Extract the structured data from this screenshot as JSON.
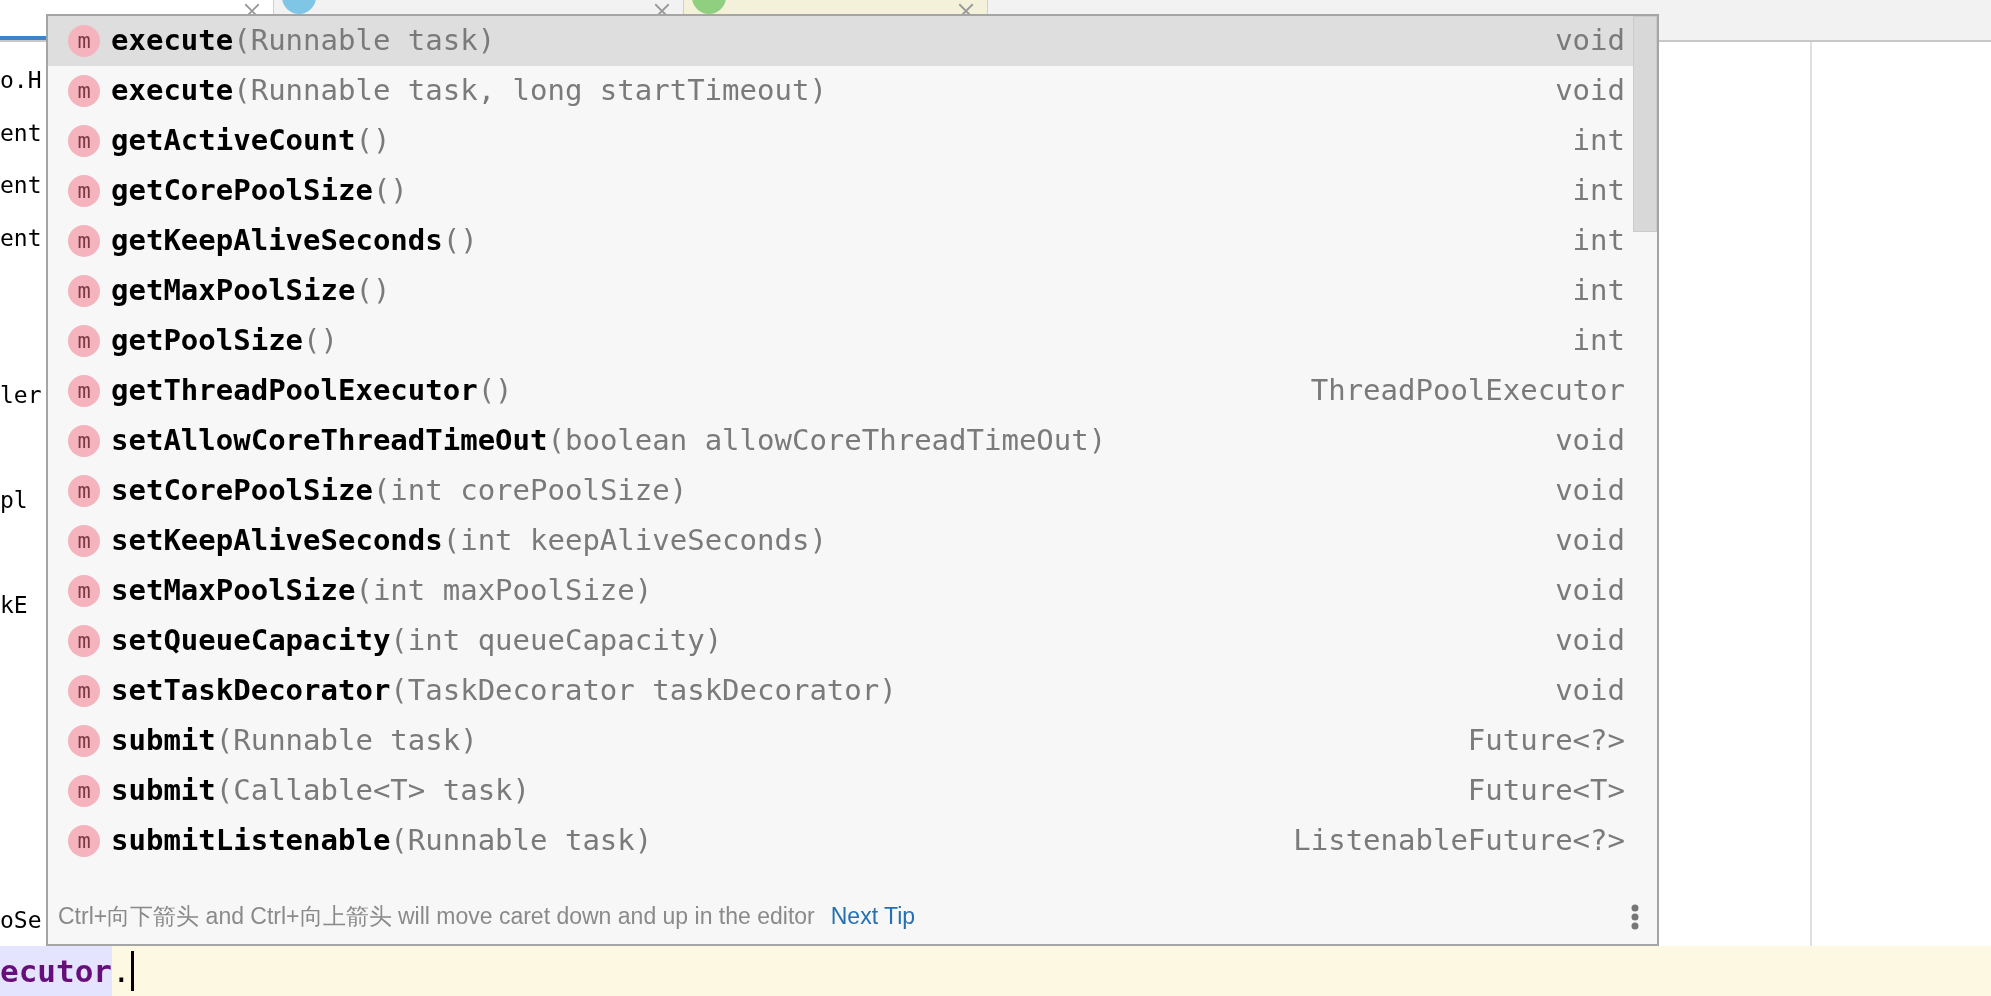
{
  "tabs": [
    {
      "kind": "plain",
      "selected": true
    },
    {
      "kind": "class",
      "selected": false
    },
    {
      "kind": "annotation",
      "selected": false
    }
  ],
  "editor": {
    "lines": [
      {
        "text": "o.H"
      },
      {
        "text": "ent"
      },
      {
        "text": "ent"
      },
      {
        "text": "ent"
      },
      {
        "text": "ler"
      },
      {
        "text": "pl"
      },
      {
        "text": "kE"
      },
      {
        "text": "oSe"
      }
    ],
    "current_line": {
      "identifier": "ecutor",
      "suffix": "."
    }
  },
  "completion": {
    "items": [
      {
        "icon": "m",
        "name": "execute",
        "params": "(Runnable task)",
        "type": "void",
        "selected": true
      },
      {
        "icon": "m",
        "name": "execute",
        "params": "(Runnable task, long startTimeout)",
        "type": "void",
        "selected": false
      },
      {
        "icon": "m",
        "name": "getActiveCount",
        "params": "()",
        "type": "int",
        "selected": false
      },
      {
        "icon": "m",
        "name": "getCorePoolSize",
        "params": "()",
        "type": "int",
        "selected": false
      },
      {
        "icon": "m",
        "name": "getKeepAliveSeconds",
        "params": "()",
        "type": "int",
        "selected": false
      },
      {
        "icon": "m",
        "name": "getMaxPoolSize",
        "params": "()",
        "type": "int",
        "selected": false
      },
      {
        "icon": "m",
        "name": "getPoolSize",
        "params": "()",
        "type": "int",
        "selected": false
      },
      {
        "icon": "m",
        "name": "getThreadPoolExecutor",
        "params": "()",
        "type": "ThreadPoolExecutor",
        "selected": false
      },
      {
        "icon": "m",
        "name": "setAllowCoreThreadTimeOut",
        "params": "(boolean allowCoreThreadTimeOut)",
        "type": "void",
        "selected": false
      },
      {
        "icon": "m",
        "name": "setCorePoolSize",
        "params": "(int corePoolSize)",
        "type": "void",
        "selected": false
      },
      {
        "icon": "m",
        "name": "setKeepAliveSeconds",
        "params": "(int keepAliveSeconds)",
        "type": "void",
        "selected": false
      },
      {
        "icon": "m",
        "name": "setMaxPoolSize",
        "params": "(int maxPoolSize)",
        "type": "void",
        "selected": false
      },
      {
        "icon": "m",
        "name": "setQueueCapacity",
        "params": "(int queueCapacity)",
        "type": "void",
        "selected": false
      },
      {
        "icon": "m",
        "name": "setTaskDecorator",
        "params": "(TaskDecorator taskDecorator)",
        "type": "void",
        "selected": false
      },
      {
        "icon": "m",
        "name": "submit",
        "params": "(Runnable task)",
        "type": "Future<?>",
        "selected": false
      },
      {
        "icon": "m",
        "name": "submit",
        "params": "(Callable<T> task)",
        "type": "Future<T>",
        "selected": false
      },
      {
        "icon": "m",
        "name": "submitListenable",
        "params": "(Runnable task)",
        "type": "ListenableFuture<?>",
        "selected": false
      }
    ],
    "hint": "Ctrl+向下箭头 and Ctrl+向上箭头 will move caret down and up in the editor",
    "link": "Next Tip"
  }
}
